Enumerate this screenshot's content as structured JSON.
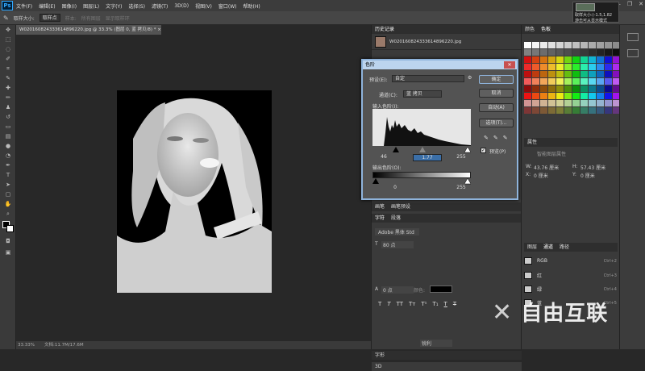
{
  "app": {
    "logo": "Ps"
  },
  "menu": [
    "文件(F)",
    "编辑(E)",
    "图像(I)",
    "图层(L)",
    "文字(Y)",
    "选择(S)",
    "滤镜(T)",
    "3D(D)",
    "视图(V)",
    "窗口(W)",
    "帮助(H)"
  ],
  "options": {
    "pattern_label": "样本:",
    "pattern_value": "所有图层",
    "mode_label": "取样大小:",
    "mode_value": "取样点",
    "checkbox": "显示取样环"
  },
  "info_box": {
    "line1": "取样大小:(-1.5,1.82",
    "line2": "游击可从显示模式"
  },
  "document": {
    "tab": "W020160824333614896220.jpg @ 33.3% (图层 0, 蓝 拷贝/8) * ×",
    "zoom": "33.33%",
    "doc_size": "文档:11.7M/17.6M"
  },
  "history": {
    "tab1": "历史记录",
    "tab2": "",
    "item": "W020160824333614896220.jpg"
  },
  "color_panel": {
    "tab1": "颜色",
    "tab2": "色板"
  },
  "dialog": {
    "title": "色阶",
    "close": "✕",
    "preset_label": "预设(E):",
    "preset_value": "自定",
    "preset_icon": "⚙",
    "channel_label": "通道(C):",
    "channel_value": "蓝 拷贝",
    "input_label": "输入色阶(I):",
    "input_values": [
      "46",
      "1.77",
      "255"
    ],
    "output_label": "输出色阶(O):",
    "output_values": [
      "0",
      "255"
    ],
    "buttons": {
      "ok": "确定",
      "cancel": "取消",
      "auto": "自动(A)",
      "options": "选项(T)..."
    },
    "preview_label": "预览(P)"
  },
  "right_panel": {
    "props_title": "属性",
    "props_sub": "智能图层属性",
    "w_label": "W:",
    "w_value": "43.76 厘米",
    "h_label": "H:",
    "h_value": "57.43 厘米",
    "x_label": "X:",
    "x_value": "0 厘米",
    "y_label": "Y:",
    "y_value": "0 厘米",
    "char_tabs": [
      "字符",
      "段落"
    ],
    "font_value": "Adobe 黑体 Std",
    "size_value": "80 点",
    "tracking_value": "0 点",
    "color_label": "颜色:",
    "mode_value": "锐利",
    "layer_tabs": [
      "图层",
      "通道",
      "路径"
    ],
    "layers": [
      {
        "name": "RGB",
        "key": "Ctrl+2"
      },
      {
        "name": "红",
        "key": "Ctrl+3"
      },
      {
        "name": "绿",
        "key": "Ctrl+4"
      },
      {
        "name": "蓝",
        "key": "Ctrl+5"
      }
    ],
    "lower_tabs": [
      "画笔",
      "画笔预设"
    ],
    "tab_bottom": "字形",
    "tab_3d": "3D"
  },
  "watermark": "自由互联"
}
